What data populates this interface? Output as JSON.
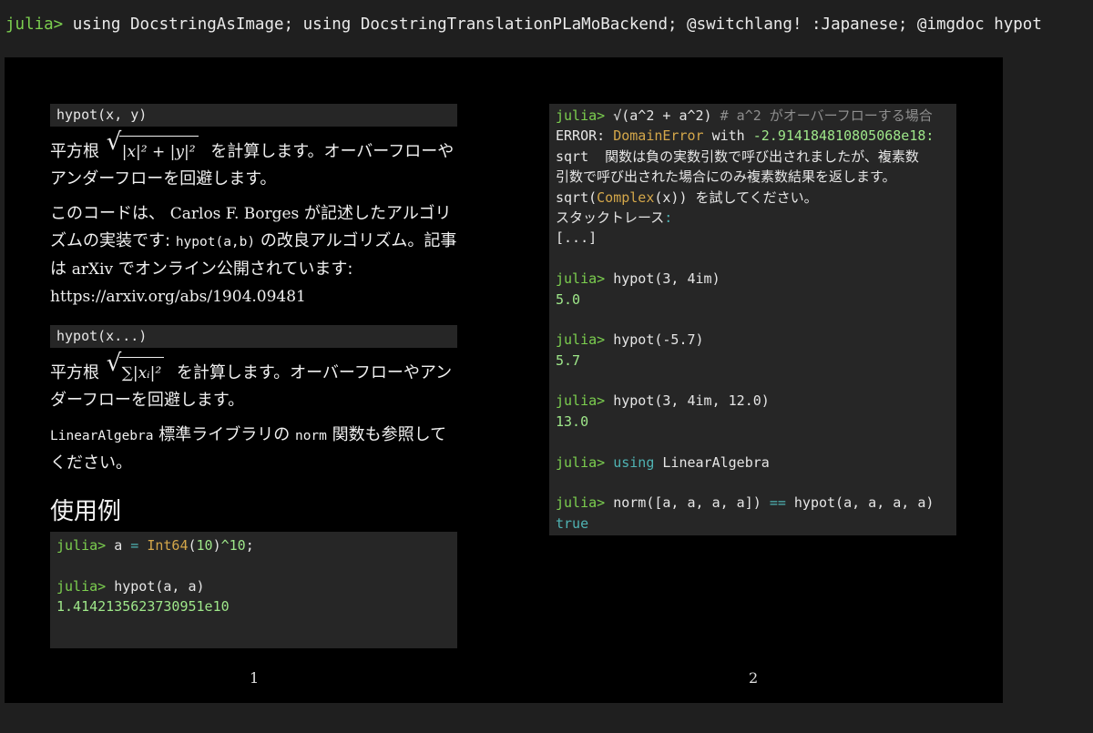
{
  "terminal": {
    "prompt": "julia>",
    "command": " using DocstringAsImage; using DocstringTranslationPLaMoBackend; @switchlang! :Japanese; @imgdoc hypot"
  },
  "page1": {
    "sig1": "hypot(x, y)",
    "p1_a": "平方根",
    "p1_math": "|x|² + |y|²",
    "p1_b": "を計算します。オーバーフローやアンダーフローを回避します。",
    "p2_a": "このコードは、",
    "p2_name": "Carlos F. Borges",
    "p2_b": "が記述したアルゴリズムの実装です:",
    "p2_code": "hypot(a,b)",
    "p2_c": "の改良アルゴリズム。記事は",
    "p2_arxiv": "arXiv",
    "p2_d": "でオンライン公開されています:",
    "p2_url": "https://arxiv.org/abs/1904.09481",
    "sig2": "hypot(x...)",
    "p3_a": "平方根",
    "p3_math": "∑|xᵢ|²",
    "p3_b": "を計算します。オーバーフローやアンダーフローを回避します。",
    "p4_code1": "LinearAlgebra",
    "p4_a": "標準ライブラリの",
    "p4_code2": "norm",
    "p4_b": "関数も参照してください。",
    "heading": "使用例",
    "code": {
      "l1_prompt": "julia>",
      "l1_a": " a ",
      "l1_eq": "=",
      "l1_type": " Int64",
      "l1_paren": "(",
      "l1_num": "10",
      "l1_close": ")",
      "l1_pow": "^10",
      "l1_end": ";",
      "l2_prompt": "julia>",
      "l2_text": " hypot(a, a)",
      "l3_out": "1.4142135623730951e10"
    },
    "number": "1"
  },
  "page2": {
    "r1_prompt": "julia>",
    "r1_text": " √(a^2 + a^2) ",
    "r1_comment": "# a^2 がオーバーフローする場合",
    "r2_err": "ERROR",
    "r2_colon": ": ",
    "r2_type": "DomainError",
    "r2_with": " with ",
    "r2_val": "-2.914184810805068e18:",
    "r3_text": "sqrt  関数は負の実数引数で呼び出されましたが、複素数",
    "r4_text": "引数で呼び出された場合にのみ複素数結果を返します。",
    "r5_a": "sqrt(",
    "r5_type": "Complex",
    "r5_b": "(x)) を試してください。",
    "r6_text": "スタックトレース",
    "r6_colon": ":",
    "r7_text": "[...]",
    "r9_prompt": "julia>",
    "r9_text": " hypot(3, 4im)",
    "r10_out": "5.0",
    "r12_prompt": "julia>",
    "r12_text": " hypot(-5.7)",
    "r13_out": "5.7",
    "r15_prompt": "julia>",
    "r15_text": " hypot(3, 4im, 12.0)",
    "r16_out": "13.0",
    "r18_prompt": "julia>",
    "r18_kw": " using",
    "r18_text": " LinearAlgebra",
    "r20_prompt": "julia>",
    "r20_a": " norm([a, a, a, a]) ",
    "r20_op": "==",
    "r20_b": " hypot(a, a, a, a)",
    "r21_out": "true",
    "number": "2"
  },
  "colors": {
    "prompt": "#7ccf4f",
    "number": "#9fe88a",
    "keyword": "#4fb3b3",
    "type": "#d4a74a",
    "comment": "#8f8f8f",
    "code_bg": "#262626"
  }
}
